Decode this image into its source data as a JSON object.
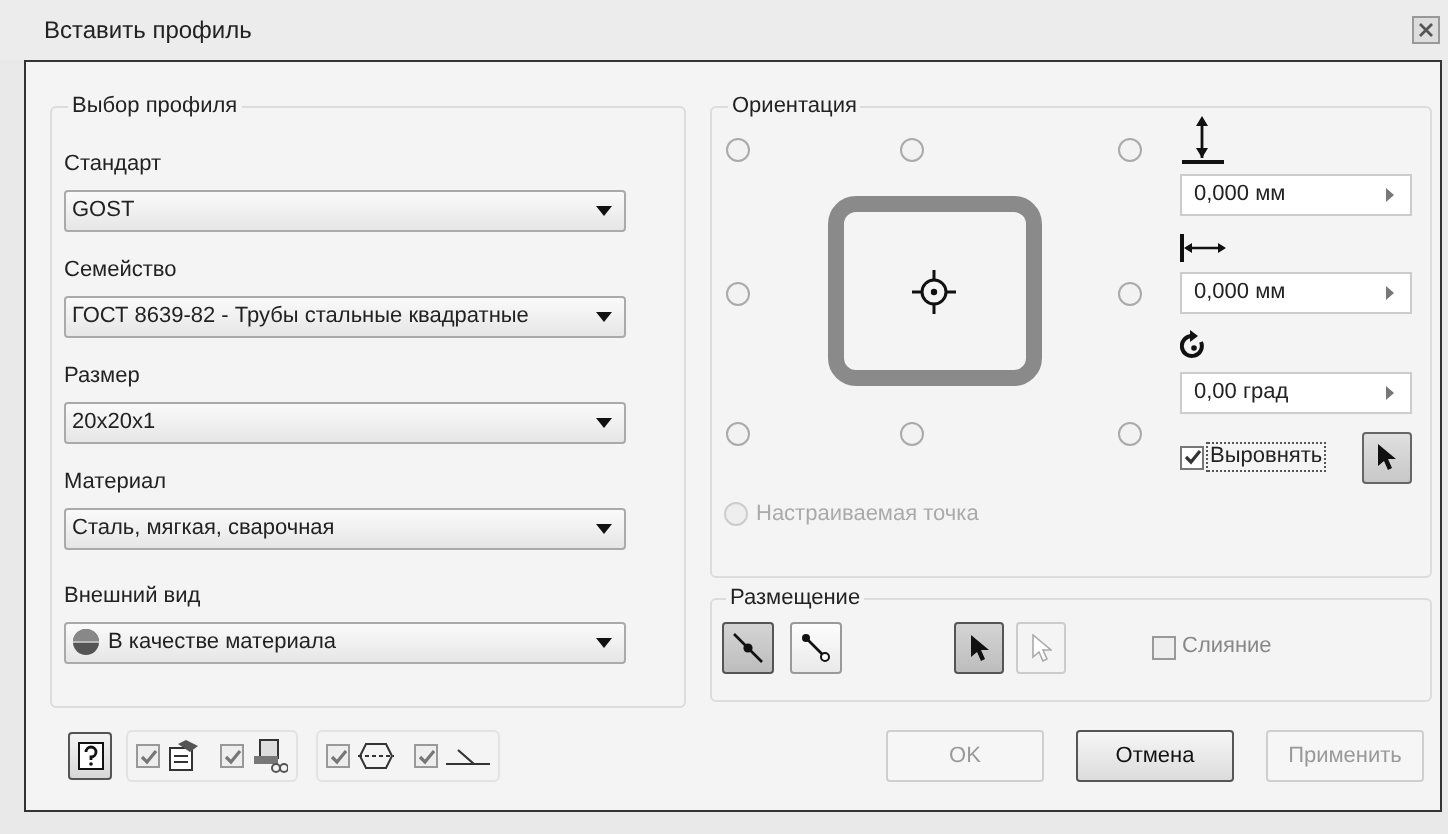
{
  "window": {
    "title": "Вставить профиль"
  },
  "profile": {
    "title": "Выбор профиля",
    "fields": [
      {
        "label": "Стандарт",
        "value": "GOST",
        "kind": "dropdown"
      },
      {
        "label": "Семейство",
        "value": "ГОСТ 8639-82 - Трубы стальные квадратные",
        "kind": "dropdown"
      },
      {
        "label": "Размер",
        "value": "20x20x1",
        "kind": "dropdown"
      },
      {
        "label": "Материал",
        "value": "Сталь, мягкая, сварочная",
        "kind": "dropdown"
      },
      {
        "label": "Внешний вид",
        "value": "В качестве материала",
        "kind": "swatch-dropdown"
      }
    ]
  },
  "toggles": [
    {
      "checked": true
    },
    {
      "checked": true
    },
    {
      "checked": true
    },
    {
      "checked": true
    }
  ],
  "orientation": {
    "title": "Ориентация",
    "anchor_points": [
      {
        "selected": false
      },
      {
        "selected": false
      },
      {
        "selected": false
      },
      {
        "selected": false
      },
      {
        "selected": false
      },
      {
        "selected": false
      },
      {
        "selected": false
      },
      {
        "selected": false
      }
    ],
    "offsets": [
      {
        "value": "0,000 мм"
      },
      {
        "value": "0,000 мм"
      },
      {
        "value": "0,00 град"
      }
    ],
    "align": {
      "label": "Выровнять",
      "checked": true
    },
    "custom_point": {
      "label": "Настраиваемая точка",
      "disabled": true,
      "selected": false
    }
  },
  "placement": {
    "title": "Размещение",
    "modes": [
      {
        "pressed": true
      },
      {
        "pressed": false
      }
    ],
    "select": [
      {
        "pressed": true,
        "disabled": false
      },
      {
        "pressed": false,
        "disabled": true
      }
    ],
    "merge": {
      "label": "Слияние",
      "checked": false
    }
  },
  "buttons": [
    {
      "label": "OK",
      "disabled": true,
      "default": false
    },
    {
      "label": "Отмена",
      "disabled": false,
      "default": true
    },
    {
      "label": "Применить",
      "disabled": true,
      "default": false
    }
  ]
}
